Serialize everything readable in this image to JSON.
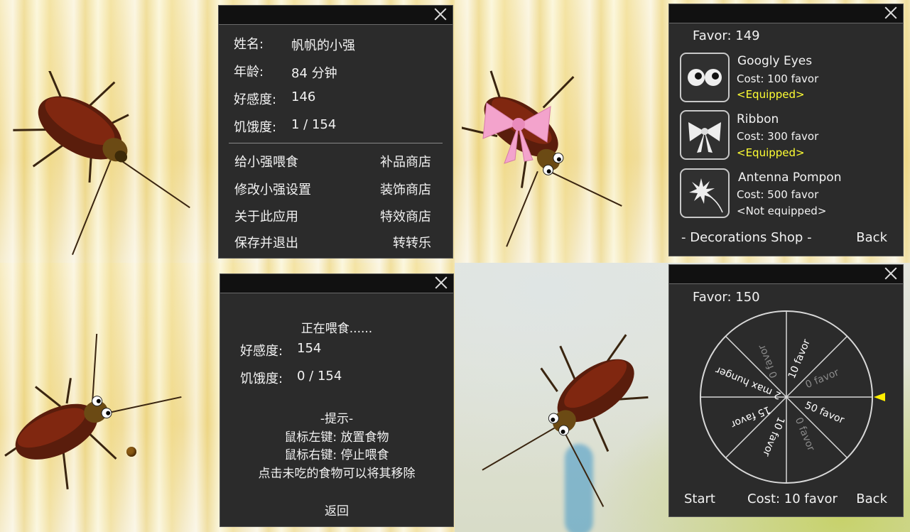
{
  "info_panel": {
    "rows": [
      {
        "label": "姓名:",
        "value": "帆帆的小强"
      },
      {
        "label": "年龄:",
        "value": "84 分钟"
      },
      {
        "label": "好感度:",
        "value": "146"
      },
      {
        "label": "饥饿度:",
        "value": "1 / 154"
      }
    ],
    "menu_left": [
      "给小强喂食",
      "修改小强设置",
      "关于此应用",
      "保存并退出"
    ],
    "menu_right": [
      "补品商店",
      "装饰商店",
      "特效商店",
      "转转乐"
    ]
  },
  "deco_shop": {
    "favor": "Favor: 149",
    "items": [
      {
        "name": "Googly Eyes",
        "cost": "Cost: 100 favor",
        "status": "<Equipped>",
        "icon": "googly-eyes-icon"
      },
      {
        "name": "Ribbon",
        "cost": "Cost: 300 favor",
        "status": "<Equipped>",
        "icon": "ribbon-icon"
      },
      {
        "name": "Antenna Pompon",
        "cost": "Cost: 500 favor",
        "status": "<Not equipped>",
        "icon": "pompon-icon"
      }
    ],
    "footer_title": "- Decorations Shop -",
    "back": "Back"
  },
  "feed_panel": {
    "status": "正在喂食......",
    "favor_label": "好感度:",
    "favor_value": "154",
    "hunger_label": "饥饿度:",
    "hunger_value": "0 / 154",
    "tip_title": "-提示-",
    "tips": [
      "鼠标左键: 放置食物",
      "鼠标右键: 停止喂食",
      "点击未吃的食物可以将其移除"
    ],
    "back": "返回"
  },
  "wheel_panel": {
    "favor": "Favor: 150",
    "segments": [
      "10 favor",
      "0 favor",
      "50 favor",
      "0 favor",
      "10 favor",
      "15 favor",
      "2 max hunger",
      "0 favor"
    ],
    "start": "Start",
    "cost": "Cost: 10 favor",
    "back": "Back",
    "colors": {
      "active_text": "#ffffff",
      "dim_text": "#8a8a8a",
      "pointer": "#ffee00"
    }
  },
  "colors": {
    "panel": "#2b2b2b",
    "titlebar": "#111111",
    "equipped": "#ffff33"
  }
}
